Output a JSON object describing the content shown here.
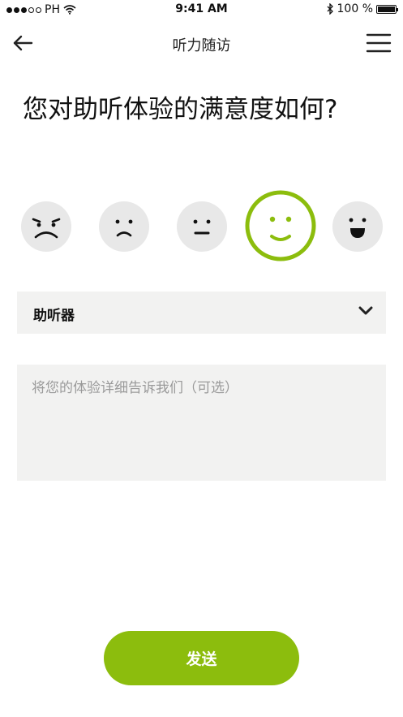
{
  "status_bar": {
    "carrier": "PH",
    "time": "9:41 AM",
    "battery_text": "100 %",
    "signal_bars_filled": 3,
    "signal_bars_total": 5,
    "battery_level": 1.0
  },
  "nav": {
    "title": "听力随访",
    "back_icon": "arrow-left-icon",
    "menu_icon": "hamburger-menu-icon"
  },
  "question": "您对助听体验的满意度如何?",
  "faces": [
    {
      "name": "very-unhappy-face-icon",
      "selected": false
    },
    {
      "name": "unhappy-face-icon",
      "selected": false
    },
    {
      "name": "neutral-face-icon",
      "selected": false
    },
    {
      "name": "happy-face-icon",
      "selected": true
    },
    {
      "name": "very-happy-face-icon",
      "selected": false
    }
  ],
  "dropdown": {
    "selected": "助听器",
    "icon": "chevron-down-icon"
  },
  "feedback": {
    "value": "",
    "placeholder": "将您的体验详细告诉我们（可选）"
  },
  "send_button": {
    "label": "发送"
  },
  "colors": {
    "accent": "#8cbd0d",
    "face_bg": "#e8e8e8",
    "field_bg": "#f2f2f1"
  }
}
